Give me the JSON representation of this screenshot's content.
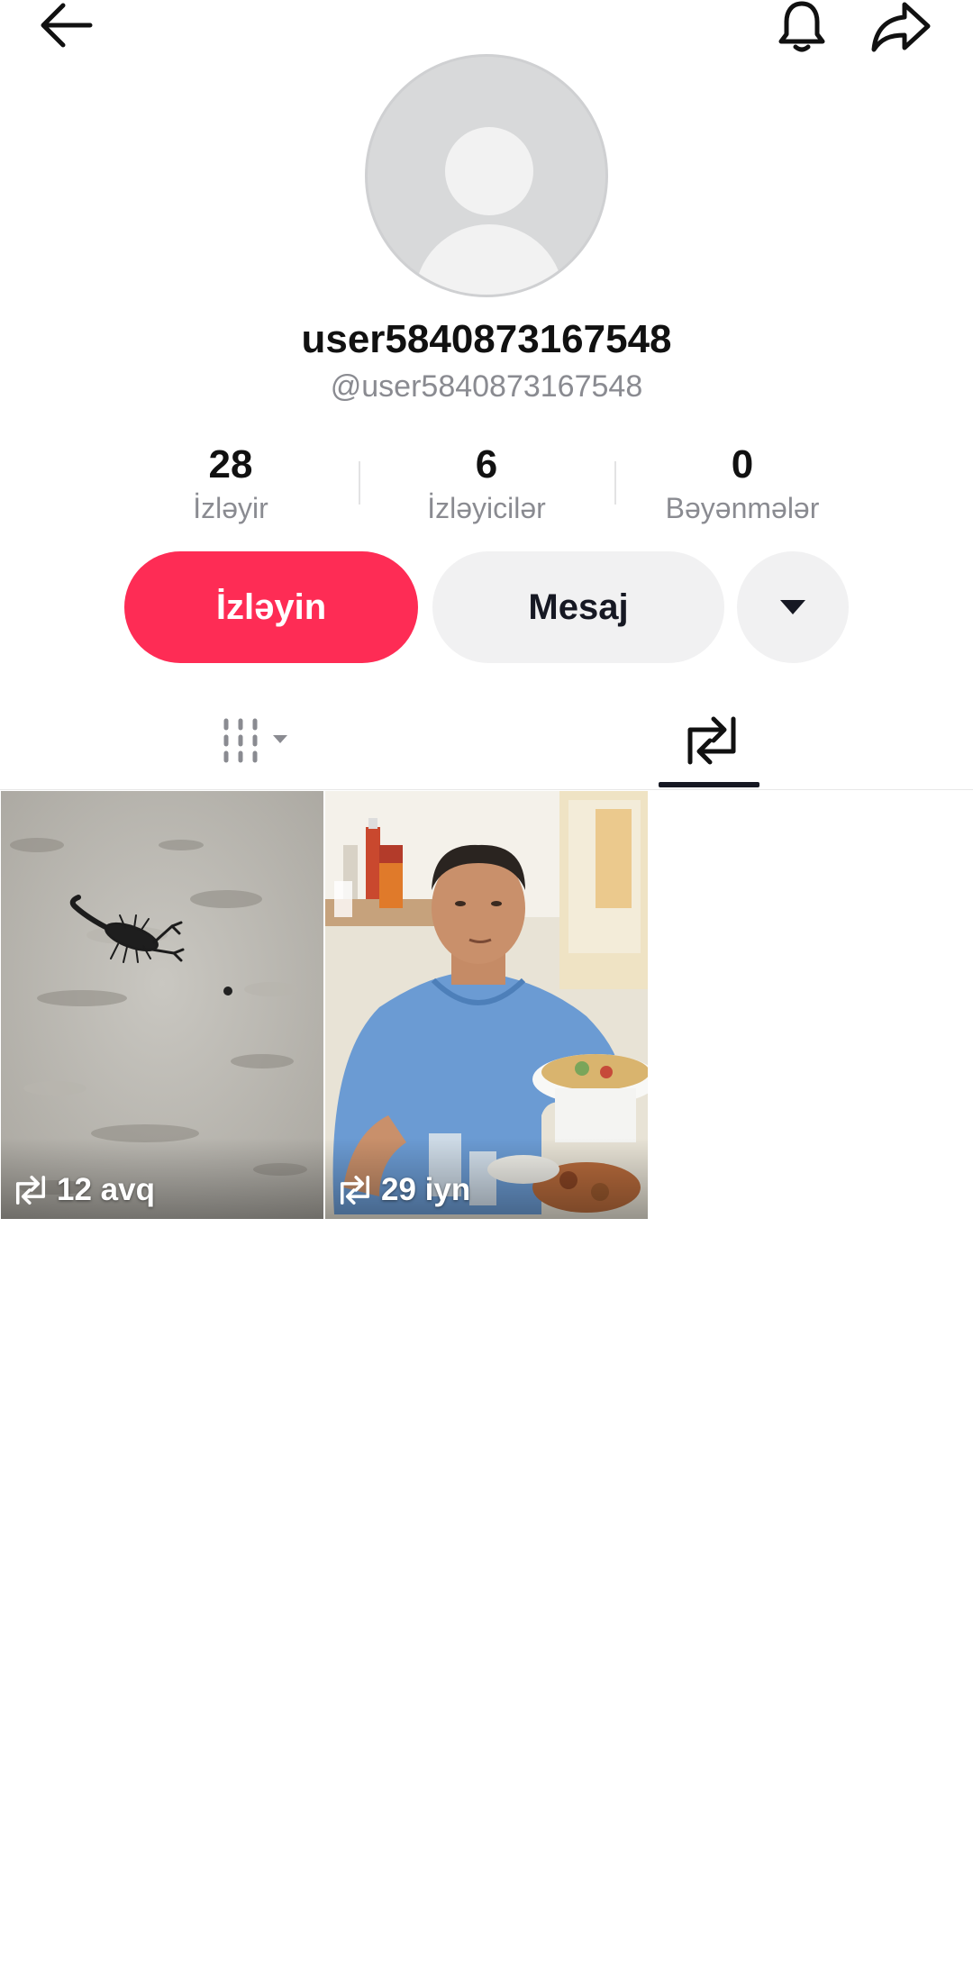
{
  "header": {
    "back_icon": "arrow-left-icon",
    "bell_icon": "bell-icon",
    "share_icon": "share-arrow-icon"
  },
  "profile": {
    "display_name": "user5840873167548",
    "handle": "@user5840873167548"
  },
  "stats": [
    {
      "value": "28",
      "label": "İzləyir"
    },
    {
      "value": "6",
      "label": "İzləyicilər"
    },
    {
      "value": "0",
      "label": "Bəyənmələr"
    }
  ],
  "actions": {
    "follow_label": "İzləyin",
    "message_label": "Mesaj",
    "more_icon": "caret-down-icon"
  },
  "tabs": {
    "videos_icon": "grid-columns-icon",
    "reposts_icon": "repost-icon",
    "active": "reposts"
  },
  "videos": [
    {
      "caption": "12 avq",
      "thumbnail": "scorpion-on-sand"
    },
    {
      "caption": "29 iyn",
      "thumbnail": "man-in-blue-shirt-at-table"
    }
  ],
  "colors": {
    "accent": "#fe2c55",
    "secondary_button": "#f1f1f2",
    "muted_text": "#8a8b91",
    "text": "#111111"
  }
}
